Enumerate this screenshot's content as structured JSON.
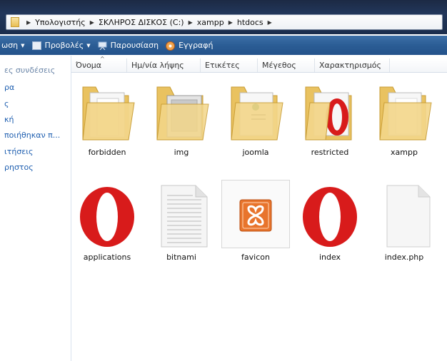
{
  "breadcrumb": [
    "Υπολογιστής",
    "ΣΚΛΗΡΟΣ ΔΙΣΚΟΣ (C:)",
    "xampp",
    "htdocs"
  ],
  "toolbar": {
    "organize_label": "ωση",
    "views_label": "Προβολές",
    "slideshow_label": "Παρουσίαση",
    "burn_label": "Εγγραφή"
  },
  "nav": {
    "items": [
      "ες συνδέσεις",
      "ρα",
      "ς",
      "κή",
      "ποιήθηκαν π...",
      "ιτήσεις",
      "ρηστος"
    ]
  },
  "columns": [
    "Όνομα",
    "Ημ/νία λήψης",
    "Ετικέτες",
    "Μέγεθος",
    "Χαρακτηρισμός"
  ],
  "files": [
    {
      "name": "forbidden",
      "icon": "folder-icon"
    },
    {
      "name": "img",
      "icon": "folder-icon"
    },
    {
      "name": "joomla",
      "icon": "folder-icon"
    },
    {
      "name": "restricted",
      "icon": "folder-icon"
    },
    {
      "name": "xampp",
      "icon": "folder-icon"
    },
    {
      "name": "applications",
      "icon": "opera-icon"
    },
    {
      "name": "bitnami",
      "icon": "text-file-icon"
    },
    {
      "name": "favicon",
      "icon": "xampp-icon"
    },
    {
      "name": "index",
      "icon": "opera-icon"
    },
    {
      "name": "index.php",
      "icon": "blank-file-icon"
    }
  ],
  "colors": {
    "address_bar": "#22375b",
    "command_bar": "#2b5d95",
    "nav_link": "#1f5fb0",
    "folder": "#f4d27e",
    "opera_red": "#d81b1b",
    "xampp_orange": "#e8742c"
  }
}
